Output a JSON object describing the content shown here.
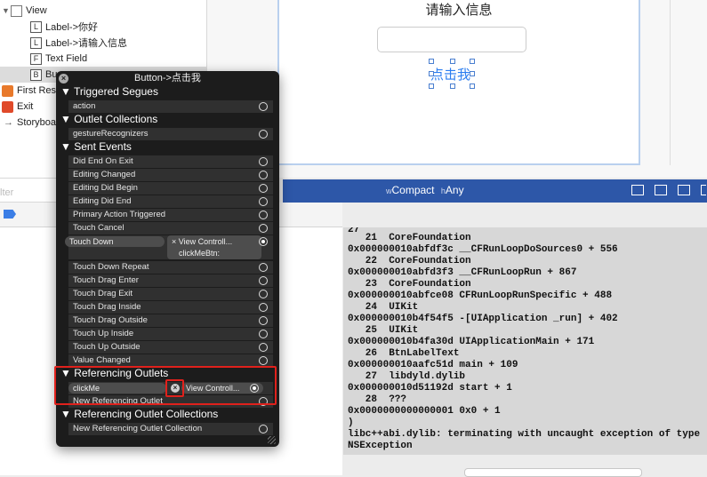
{
  "outline": {
    "items": [
      {
        "icon": "view-icon",
        "glyph": "",
        "label": "View"
      },
      {
        "icon": "label-icon",
        "glyph": "L",
        "label": "Label->你好"
      },
      {
        "icon": "label-icon",
        "glyph": "L",
        "label": "Label->请输入信息"
      },
      {
        "icon": "textfield-icon",
        "glyph": "F",
        "label": "Text Field"
      },
      {
        "icon": "button-icon",
        "glyph": "B",
        "label": "Bu"
      },
      {
        "icon": "first-responder-icon",
        "glyph": "",
        "label": "First Res"
      },
      {
        "icon": "exit-icon",
        "glyph": "",
        "label": "Exit"
      },
      {
        "icon": "storyboard-icon",
        "glyph": "→",
        "label": "Storyboa"
      }
    ],
    "filter_placeholder": "lter"
  },
  "canvas": {
    "title_label": "请输入信息",
    "button_label": "点击我"
  },
  "size_class": {
    "w_prefix": "w",
    "w_value": "Compact",
    "h_prefix": "h",
    "h_value": "Any"
  },
  "popup": {
    "title": "Button->点击我",
    "close_glyph": "×",
    "sections": {
      "triggered_segues": "Triggered Segues",
      "outlet_collections": "Outlet Collections",
      "sent_events": "Sent Events",
      "referencing_outlets": "Referencing Outlets",
      "referencing_outlet_collections": "Referencing Outlet Collections"
    },
    "triggered_segues_rows": [
      "action"
    ],
    "outlet_collections_rows": [
      "gestureRecognizers"
    ],
    "sent_events_rows": [
      "Did End On Exit",
      "Editing Changed",
      "Editing Did Begin",
      "Editing Did End",
      "Primary Action Triggered",
      "Touch Cancel",
      "Touch Down",
      "Touch Down Repeat",
      "Touch Drag Enter",
      "Touch Drag Exit",
      "Touch Drag Inside",
      "Touch Drag Outside",
      "Touch Up Inside",
      "Touch Up Outside",
      "Value Changed"
    ],
    "touch_down_connection": {
      "target": "View Controll...",
      "action": "clickMeBtn:"
    },
    "referencing_outlets_rows": [
      "clickMe",
      "New Referencing Outlet"
    ],
    "click_me_connection": {
      "target": "View Controll..."
    },
    "referencing_outlet_collections_rows": [
      "New Referencing Outlet Collection"
    ]
  },
  "console": {
    "lines": [
      "27",
      "   21  CoreFoundation",
      "0x000000010abfdf3c __CFRunLoopDoSources0 + 556",
      "   22  CoreFoundation",
      "0x000000010abfd3f3 __CFRunLoopRun + 867",
      "   23  CoreFoundation",
      "0x000000010abfce08 CFRunLoopRunSpecific + 488",
      "   24  UIKit",
      "0x000000010b4f54f5 -[UIApplication _run] + 402",
      "   25  UIKit",
      "0x000000010b4fa30d UIApplicationMain + 171",
      "   26  BtnLabelText",
      "0x000000010aafc51d main + 109",
      "   27  libdyld.dylib",
      "0x000000010d51192d start + 1",
      "   28  ???",
      "0x0000000000000001 0x0 + 1",
      ")",
      "libc++abi.dylib: terminating with uncaught exception of type",
      "NSException"
    ]
  },
  "colors": {
    "accent_blue": "#2d57a8",
    "highlight_red": "#e0211c",
    "button_blue": "#2b7df0"
  }
}
